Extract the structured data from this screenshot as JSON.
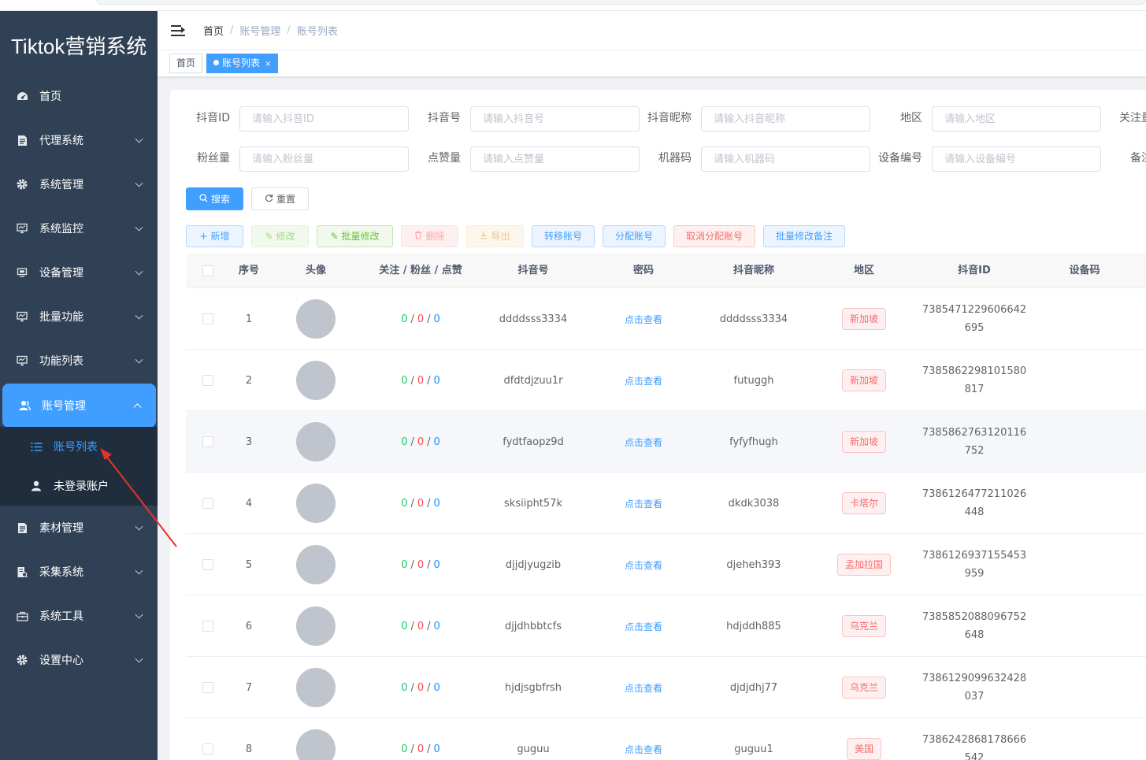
{
  "app": {
    "logo": "Tiktok营销系统"
  },
  "sidebar": {
    "items": [
      {
        "label": "首页",
        "icon": "dashboard-icon"
      },
      {
        "label": "代理系统",
        "icon": "document-icon"
      },
      {
        "label": "系统管理",
        "icon": "gear-icon"
      },
      {
        "label": "系统监控",
        "icon": "monitor-icon"
      },
      {
        "label": "设备管理",
        "icon": "device-icon"
      },
      {
        "label": "批量功能",
        "icon": "monitor-icon"
      },
      {
        "label": "功能列表",
        "icon": "monitor-icon"
      },
      {
        "label": "账号管理",
        "icon": "users-icon"
      },
      {
        "label": "素材管理",
        "icon": "document-icon"
      },
      {
        "label": "采集系统",
        "icon": "collect-icon"
      },
      {
        "label": "系统工具",
        "icon": "toolbox-icon"
      },
      {
        "label": "设置中心",
        "icon": "gear-icon"
      }
    ],
    "sub_items": [
      {
        "label": "账号列表",
        "icon": "list-icon"
      },
      {
        "label": "未登录账户",
        "icon": "user-icon"
      }
    ]
  },
  "breadcrumb": {
    "home": "首页",
    "level1": "账号管理",
    "level2": "账号列表",
    "sep": "/"
  },
  "tags": {
    "home": "首页",
    "active": "账号列表",
    "close": "×"
  },
  "filters": {
    "row1": [
      {
        "label": "抖音ID",
        "placeholder": "请输入抖音ID"
      },
      {
        "label": "抖音号",
        "placeholder": "请输入抖音号"
      },
      {
        "label": "抖音昵称",
        "placeholder": "请输入抖音昵称"
      },
      {
        "label": "地区",
        "placeholder": "请输入地区"
      },
      {
        "label": "关注量"
      }
    ],
    "row2": [
      {
        "label": "粉丝量",
        "placeholder": "请输入粉丝量"
      },
      {
        "label": "点赞量",
        "placeholder": "请输入点赞量"
      },
      {
        "label": "机器码",
        "placeholder": "请输入机器码"
      },
      {
        "label": "设备编号",
        "placeholder": "请输入设备编号"
      },
      {
        "label": "备注"
      }
    ]
  },
  "search_buttons": {
    "search": "搜索",
    "reset": "重置"
  },
  "toolbar": {
    "add": "新增",
    "edit": "修改",
    "batch_edit": "批量修改",
    "delete": "删除",
    "export": "导出",
    "transfer": "转移账号",
    "assign": "分配账号",
    "unassign": "取消分配账号",
    "batch_remark": "批量修改备注"
  },
  "table": {
    "columns": [
      "序号",
      "头像",
      "关注 / 粉丝 / 点赞",
      "抖音号",
      "密码",
      "抖音昵称",
      "地区",
      "抖音ID",
      "设备码"
    ],
    "view_password": "点击查看",
    "rows": [
      {
        "index": "1",
        "follow": "0",
        "fans": "0",
        "likes": "0",
        "douyin_no": "ddddsss3334",
        "nickname": "ddddsss3334",
        "region": "新加坡",
        "douyin_id": "7385471229606642695"
      },
      {
        "index": "2",
        "follow": "0",
        "fans": "0",
        "likes": "0",
        "douyin_no": "dfdtdjzuu1r",
        "nickname": "futuggh",
        "region": "新加坡",
        "douyin_id": "7385862298101580817"
      },
      {
        "index": "3",
        "follow": "0",
        "fans": "0",
        "likes": "0",
        "douyin_no": "fydtfaopz9d",
        "nickname": "fyfyfhugh",
        "region": "新加坡",
        "douyin_id": "7385862763120116752"
      },
      {
        "index": "4",
        "follow": "0",
        "fans": "0",
        "likes": "0",
        "douyin_no": "sksiipht57k",
        "nickname": "dkdk3038",
        "region": "卡塔尔",
        "douyin_id": "7386126477211026448"
      },
      {
        "index": "5",
        "follow": "0",
        "fans": "0",
        "likes": "0",
        "douyin_no": "djjdjyugzib",
        "nickname": "djeheh393",
        "region": "孟加拉国",
        "douyin_id": "7386126937155453959"
      },
      {
        "index": "6",
        "follow": "0",
        "fans": "0",
        "likes": "0",
        "douyin_no": "djjdhbbtcfs",
        "nickname": "hdjddh885",
        "region": "乌克兰",
        "douyin_id": "7385852088096752648"
      },
      {
        "index": "7",
        "follow": "0",
        "fans": "0",
        "likes": "0",
        "douyin_no": "hjdjsgbfrsh",
        "nickname": "djdjdhj77",
        "region": "乌克兰",
        "douyin_id": "7386129099632428037"
      },
      {
        "index": "8",
        "follow": "0",
        "fans": "0",
        "likes": "0",
        "douyin_no": "guguu",
        "nickname": "guguu1",
        "region": "美国",
        "douyin_id": "7386242868178666542"
      }
    ]
  },
  "colors": {
    "accent": "#409eff",
    "sidebar_bg": "#304156",
    "follow": "#13ce66",
    "fans": "#ff4949",
    "likes": "#1890ff",
    "annotation": "#e8312c"
  }
}
